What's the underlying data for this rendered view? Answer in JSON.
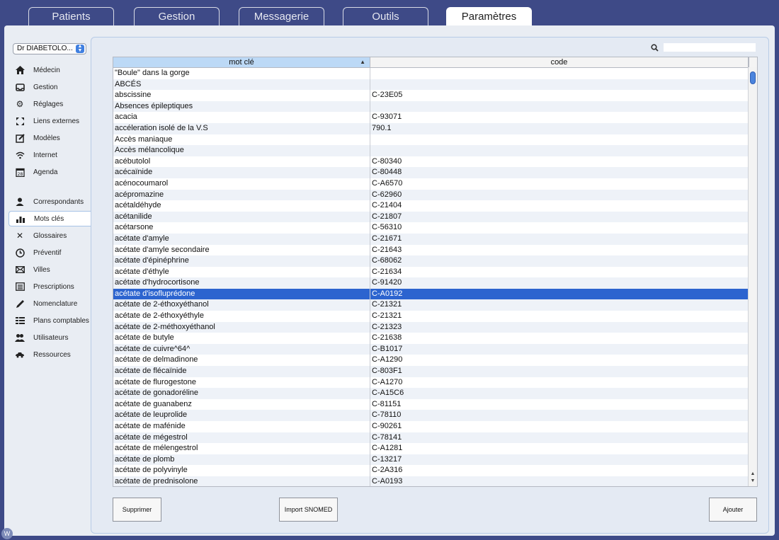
{
  "tabs": [
    {
      "label": "Patients"
    },
    {
      "label": "Gestion"
    },
    {
      "label": "Messagerie"
    },
    {
      "label": "Outils"
    },
    {
      "label": "Paramètres",
      "active": true
    }
  ],
  "doctor_select": {
    "value": "Dr DIABETOLO..."
  },
  "sidebar": {
    "group1": [
      {
        "label": "Médecin",
        "icon": "house-icon"
      },
      {
        "label": "Gestion",
        "icon": "tray-icon"
      },
      {
        "label": "Réglages",
        "icon": "gear-icon"
      },
      {
        "label": "Liens externes",
        "icon": "expand-icon"
      },
      {
        "label": "Modèles",
        "icon": "edit-icon"
      },
      {
        "label": "Internet",
        "icon": "wifi-icon"
      },
      {
        "label": "Agenda",
        "icon": "calendar-icon"
      }
    ],
    "group2": [
      {
        "label": "Correspondants",
        "icon": "person-icon"
      },
      {
        "label": "Mots clés",
        "icon": "bar-chart-icon",
        "selected": true
      },
      {
        "label": "Glossaires",
        "icon": "tools-icon"
      },
      {
        "label": "Préventif",
        "icon": "clock-icon"
      },
      {
        "label": "Villes",
        "icon": "envelope-icon"
      },
      {
        "label": "Prescriptions",
        "icon": "list-icon"
      },
      {
        "label": "Nomenclature",
        "icon": "pen-icon"
      },
      {
        "label": "Plans comptables",
        "icon": "table-icon"
      },
      {
        "label": "Utilisateurs",
        "icon": "users-icon"
      },
      {
        "label": "Ressources",
        "icon": "car-icon"
      }
    ]
  },
  "search": {
    "placeholder": ""
  },
  "table": {
    "columns": [
      "mot clé",
      "code"
    ],
    "selected_index": 20,
    "rows": [
      [
        "\"Boule\" dans la gorge",
        ""
      ],
      [
        "ABCÉS",
        ""
      ],
      [
        "abscissine",
        "C-23E05"
      ],
      [
        "Absences épileptiques",
        ""
      ],
      [
        "acacia",
        "C-93071"
      ],
      [
        "accéleration isolé de la V.S",
        "790.1"
      ],
      [
        "Accès maniaque",
        ""
      ],
      [
        "Accès mélancolique",
        ""
      ],
      [
        "acébutolol",
        "C-80340"
      ],
      [
        "acécaïnide",
        "C-80448"
      ],
      [
        "acénocoumarol",
        "C-A6570"
      ],
      [
        "acépromazine",
        "C-62960"
      ],
      [
        "acétaldéhyde",
        "C-21404"
      ],
      [
        "acétanilide",
        "C-21807"
      ],
      [
        "acétarsone",
        "C-56310"
      ],
      [
        "acétate d'amyle",
        "C-21671"
      ],
      [
        "acétate d'amyle secondaire",
        "C-21643"
      ],
      [
        "acétate d'épinéphrine",
        "C-68062"
      ],
      [
        "acétate d'éthyle",
        "C-21634"
      ],
      [
        "acétate d'hydrocortisone",
        "C-91420"
      ],
      [
        "acétate d'isofluprédone",
        "C-A0192"
      ],
      [
        "acétate de 2-éthoxyéthanol",
        "C-21321"
      ],
      [
        "acétate de 2-éthoxyéthyle",
        "C-21321"
      ],
      [
        "acétate de 2-méthoxyéthanol",
        "C-21323"
      ],
      [
        "acétate de butyle",
        "C-21638"
      ],
      [
        "acétate de cuivre^64^",
        "C-B1017"
      ],
      [
        "acétate de delmadinone",
        "C-A1290"
      ],
      [
        "acétate de flécaïnide",
        "C-803F1"
      ],
      [
        "acétate de flurogestone",
        "C-A1270"
      ],
      [
        "acétate de gonadoréline",
        "C-A15C6"
      ],
      [
        "acétate de guanabenz",
        "C-81151"
      ],
      [
        "acétate de leuprolide",
        "C-78110"
      ],
      [
        "acétate de mafénide",
        "C-90261"
      ],
      [
        "acétate de mégestrol",
        "C-78141"
      ],
      [
        "acétate de mélengestrol",
        "C-A1281"
      ],
      [
        "acétate de plomb",
        "C-13217"
      ],
      [
        "acétate de polyvinyle",
        "C-2A316"
      ],
      [
        "acétate de prednisolone",
        "C-A0193"
      ]
    ]
  },
  "buttons": {
    "delete": "Supprimer",
    "import": "Import SNOMED",
    "add": "Ajouter"
  },
  "corner_badge": "W"
}
